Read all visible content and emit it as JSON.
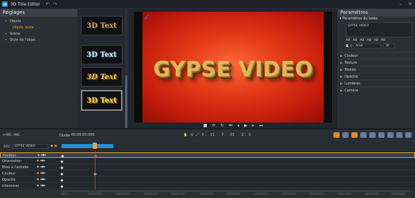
{
  "app": {
    "title": "3D Title Editor",
    "logo_text": "3D",
    "undo_icon": "undo-icon",
    "redo_icon": "redo-icon"
  },
  "left_panel": {
    "header": "Réglages",
    "items": [
      {
        "label": "Objets",
        "active": false
      },
      {
        "label": "Objets texte",
        "active": true
      },
      {
        "label": "Scène",
        "active": false
      },
      {
        "label": "Style de l'objet",
        "active": false
      }
    ]
  },
  "thumbnails": [
    {
      "label": "3D Text",
      "style": "bronze"
    },
    {
      "label": "3D Text",
      "style": "silver"
    },
    {
      "label": "3D Text",
      "style": "gold-italic"
    },
    {
      "label": "3D Text",
      "style": "gold",
      "selected": true
    }
  ],
  "preview": {
    "title_text": "GYPSE VIDEO",
    "background_color": "#e43b18"
  },
  "right_panel": {
    "title": "Paramètres",
    "section_text": "Paramètres du texte",
    "text_value": "GYPSE VIDEO",
    "format_buttons": [
      "AB",
      "AB",
      "AB",
      "AB",
      "AB",
      "AB"
    ],
    "bold": "B",
    "italic": "I",
    "font": "Arial",
    "size": "36",
    "sections": [
      "Couleur",
      "Texture",
      "Biseau",
      "Opacité",
      "Lumières",
      "Caméra"
    ]
  },
  "timeline": {
    "add_text_label": "+ABC",
    "remove_text_label": "-ABC",
    "duree_label": "Durée",
    "duree_value": "00:00:03:000",
    "x_label": "X :",
    "x_value": "-11",
    "y_label": "Y :",
    "y_value": "-23",
    "z_label": "Z :",
    "z_value": "0",
    "abc_label": "ABC",
    "object_select": "GYPSE VIDEO",
    "tracks": [
      {
        "name": "Position",
        "selected": true
      },
      {
        "name": "Orientation",
        "selected": false
      },
      {
        "name": "Mise à l'échelle",
        "selected": false
      },
      {
        "name": "Couleur",
        "selected": false
      },
      {
        "name": "Opacité",
        "selected": false
      },
      {
        "name": "Intensiver",
        "selected": false
      }
    ],
    "ruler_labels": [
      "00:00",
      "00:00:00:50",
      "00:00:01:00",
      "00:00:01:50",
      "00:00:02:00",
      "00:00:02:50",
      "00:00:03:00",
      "00:00:03:50",
      "00:00:04:00",
      "00:00:04:50",
      "00:00:05:00",
      "00:00:05:50",
      "00:00:06:00"
    ]
  },
  "colors": {
    "accent": "#f0a030",
    "blue": "#1e8fd8",
    "playhead": "#d04030"
  }
}
